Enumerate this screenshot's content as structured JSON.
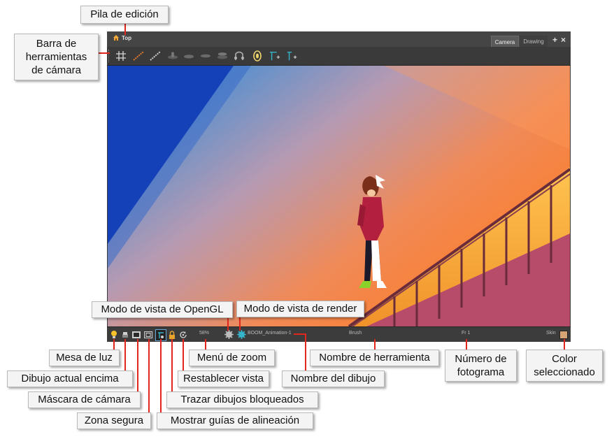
{
  "window": {
    "breadcrumb": "Top",
    "tabs": {
      "camera": "Camera",
      "drawing": "Drawing"
    },
    "buttons": {
      "add": "+",
      "close": "×"
    }
  },
  "statusbar": {
    "zoom": "58%",
    "drawing_name": "BOOM_Animation-1",
    "tool_name": "Brush",
    "frame": "Fr 1",
    "color_name": "Skin",
    "color_swatch": "#d6a475"
  },
  "callouts": {
    "edit_stack": "Pila de edición",
    "camera_toolbar": "Barra de herramientas de cámara",
    "opengl_view": "Modo de vista de OpenGL",
    "render_view": "Modo de vista de render",
    "light_table": "Mesa de luz",
    "current_on_top": "Dibujo actual encima",
    "camera_mask": "Máscara de cámara",
    "safe_area": "Zona segura",
    "zoom_menu": "Menú de zoom",
    "reset_view": "Restablecer vista",
    "onion_locked": "Trazar dibujos bloqueados",
    "alignment_guides": "Mostrar guías de alineación",
    "tool_name": "Nombre de herramienta",
    "drawing_name": "Nombre del dibujo",
    "frame_number": "Número de fotograma",
    "selected_color": "Color seleccionado"
  },
  "colors": {
    "accent_red": "#e0261d",
    "icon_orange": "#e07a2e",
    "icon_teal": "#35b3c9",
    "light_yellow": "#f6c12a"
  }
}
